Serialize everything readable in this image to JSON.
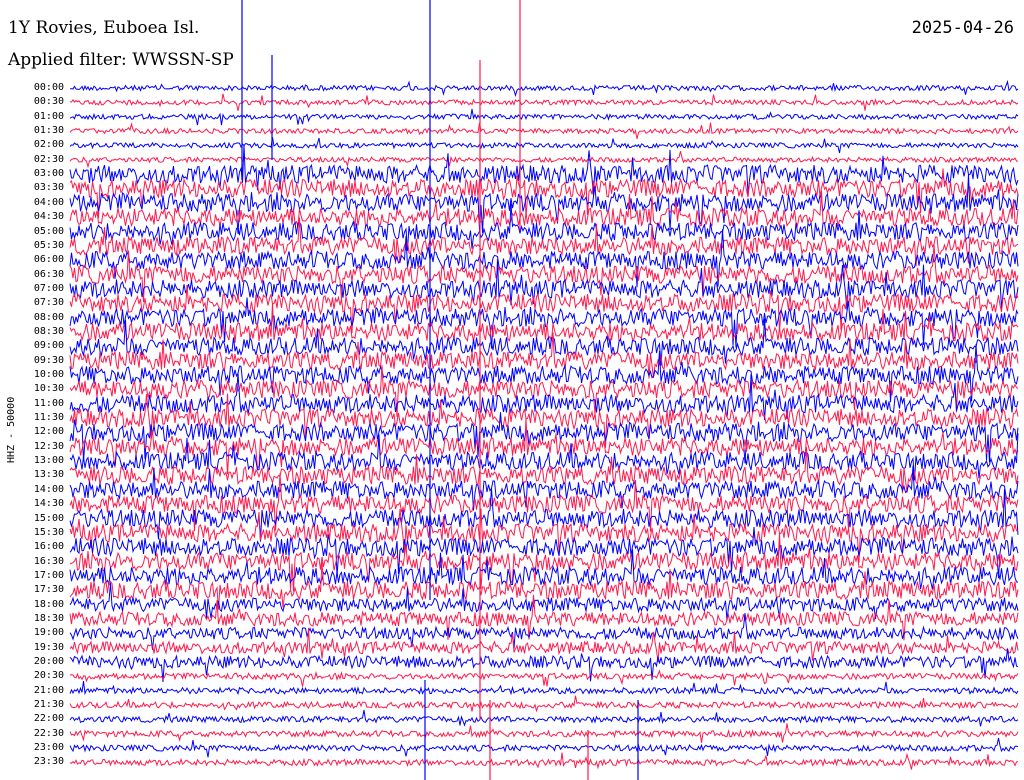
{
  "header": {
    "station": "1Y Rovies, Euboea Isl.",
    "filter": "Applied filter: WWSSN-SP",
    "date": "2025-04-26"
  },
  "channel_label": "HHZ - 50000",
  "trace_colors": [
    "#0000ff",
    "#ff1a4d"
  ],
  "time_labels": [
    "00:00",
    "00:30",
    "01:00",
    "01:30",
    "02:00",
    "02:30",
    "03:00",
    "03:30",
    "04:00",
    "04:30",
    "05:00",
    "05:30",
    "06:00",
    "06:30",
    "07:00",
    "07:30",
    "08:00",
    "08:30",
    "09:00",
    "09:30",
    "10:00",
    "10:30",
    "11:00",
    "11:30",
    "12:00",
    "12:30",
    "13:00",
    "13:30",
    "14:00",
    "14:30",
    "15:00",
    "15:30",
    "16:00",
    "16:30",
    "17:00",
    "17:30",
    "18:00",
    "18:30",
    "19:00",
    "19:30",
    "20:00",
    "20:30",
    "21:00",
    "21:30",
    "22:00",
    "22:30",
    "23:00",
    "23:30"
  ]
}
